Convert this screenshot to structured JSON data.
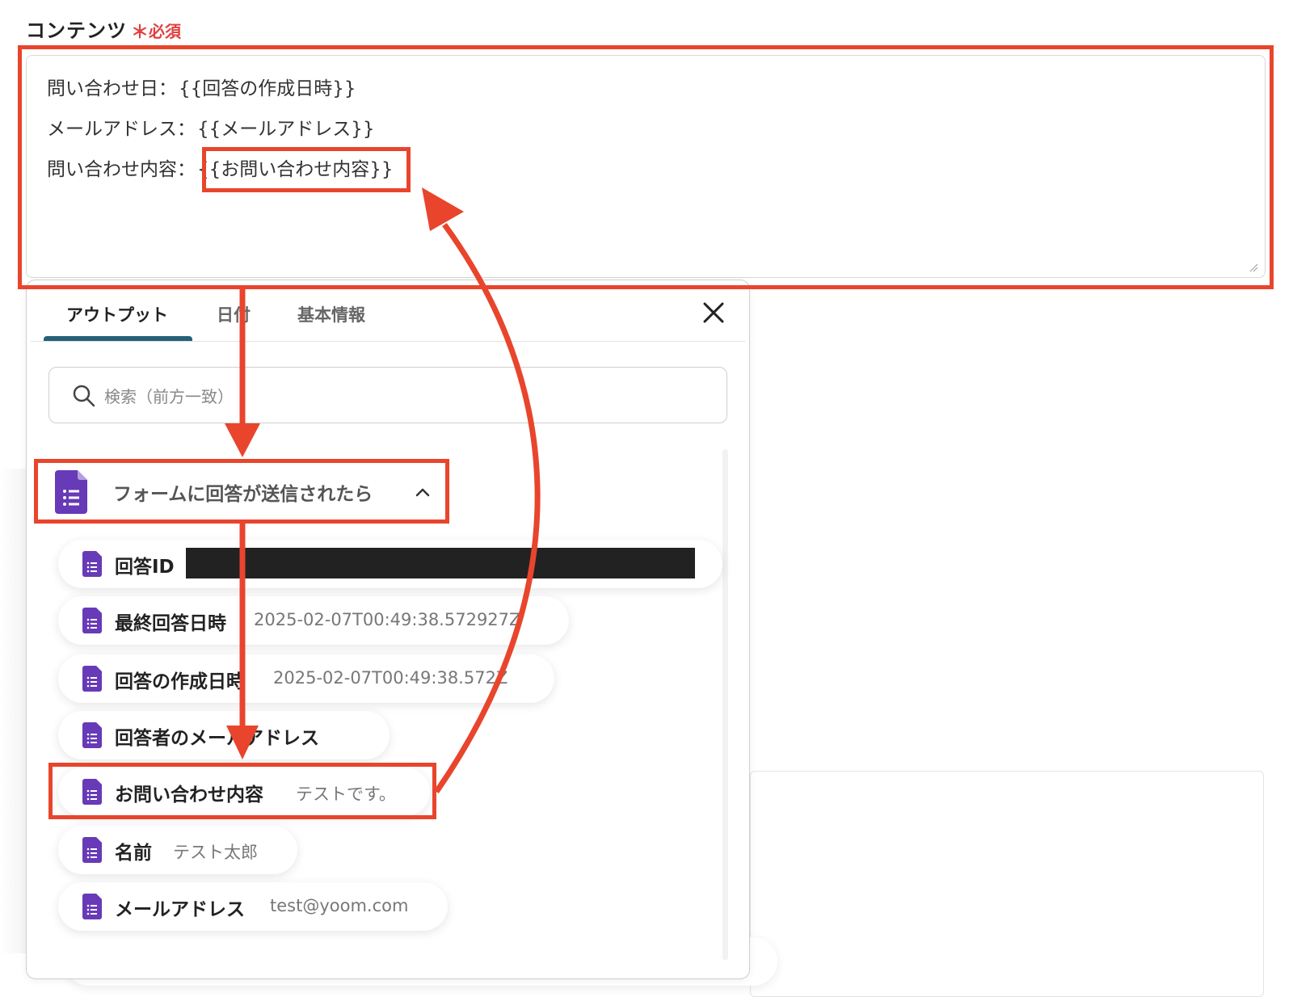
{
  "field": {
    "label": "コンテンツ",
    "required_star": "＊",
    "required_text": "必須"
  },
  "textarea": {
    "lines": [
      {
        "prefix": "問い合わせ日：",
        "token": "{{回答の作成日時}}"
      },
      {
        "prefix": "メールアドレス：",
        "token": "{{メールアドレス}}"
      },
      {
        "prefix": "問い合わせ内容：",
        "token": "{{お問い合わせ内容}}"
      }
    ]
  },
  "panel": {
    "tabs": [
      {
        "label": "アウトプット",
        "active": true
      },
      {
        "label": "日付",
        "active": false
      },
      {
        "label": "基本情報",
        "active": false
      }
    ],
    "close_icon": "close-icon",
    "search": {
      "placeholder": "検索（前方一致）",
      "icon": "search-icon"
    },
    "group": {
      "title": "フォームに回答が送信されたら",
      "icon": "google-forms-icon",
      "expanded": true
    },
    "items": [
      {
        "label": "回答ID",
        "value": "",
        "redacted": true
      },
      {
        "label": "最終回答日時",
        "value": "2025-02-07T00:49:38.572927Z"
      },
      {
        "label": "回答の作成日時",
        "value": "2025-02-07T00:49:38.572Z"
      },
      {
        "label": "回答者のメールアドレス",
        "value": ""
      },
      {
        "label": "お問い合わせ内容",
        "value": "テストです。"
      },
      {
        "label": "名前",
        "value": "テスト太郎"
      },
      {
        "label": "メールアドレス",
        "value": "test@yoom.com"
      }
    ]
  },
  "colors": {
    "highlight": "#e8452c",
    "required": "#e0403f",
    "tab_underline": "#26607a",
    "forms_purple": "#673ab7"
  }
}
